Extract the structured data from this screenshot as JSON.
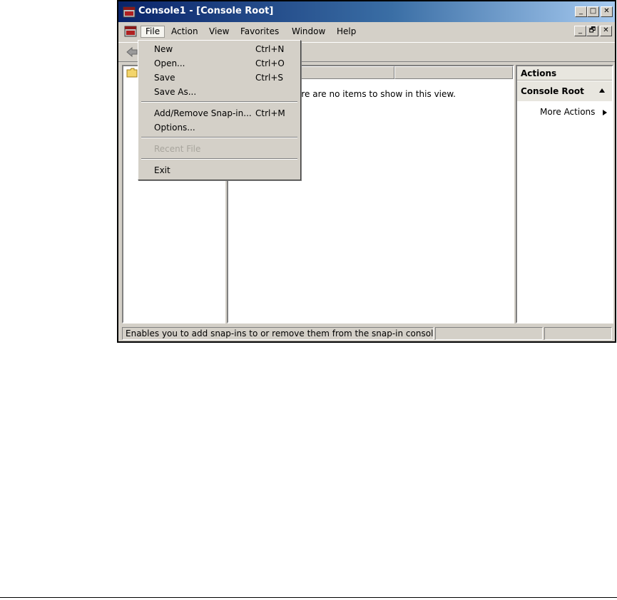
{
  "window": {
    "title": "Console1 - [Console Root]",
    "caption_buttons": {
      "minimize": "_",
      "maximize": "□",
      "close": "✕"
    },
    "mdi_buttons": {
      "minimize": "_",
      "restore": "🗗",
      "close": "✕"
    }
  },
  "menubar": {
    "items": [
      "File",
      "Action",
      "View",
      "Favorites",
      "Window",
      "Help"
    ],
    "active": "File"
  },
  "file_menu": {
    "groups": [
      [
        {
          "label": "New",
          "shortcut": "Ctrl+N",
          "enabled": true
        },
        {
          "label": "Open...",
          "shortcut": "Ctrl+O",
          "enabled": true
        },
        {
          "label": "Save",
          "shortcut": "Ctrl+S",
          "enabled": true
        },
        {
          "label": "Save As...",
          "shortcut": "",
          "enabled": true
        }
      ],
      [
        {
          "label": "Add/Remove Snap-in...",
          "shortcut": "Ctrl+M",
          "enabled": true
        },
        {
          "label": "Options...",
          "shortcut": "",
          "enabled": true
        }
      ],
      [
        {
          "label": "Recent File",
          "shortcut": "",
          "enabled": false
        }
      ],
      [
        {
          "label": "Exit",
          "shortcut": "",
          "enabled": true
        }
      ]
    ]
  },
  "list_pane": {
    "empty_message": "ere are no items to show in this view."
  },
  "actions_pane": {
    "header": "Actions",
    "section_title": "Console Root",
    "more_actions": "More Actions"
  },
  "statusbar": {
    "text": "Enables you to add snap-ins to or remove them from the snap-in console."
  },
  "colors": {
    "title_gradient_start": "#0a246a",
    "title_gradient_end": "#a6caf0",
    "face": "#d4d0c8",
    "disabled_text": "#a8a59d"
  },
  "icons": {
    "app": "mmc-console-icon",
    "back": "back-arrow-icon",
    "tree_node": "folder-icon",
    "collapse": "triangle-up-icon",
    "submenu": "triangle-right-icon"
  }
}
